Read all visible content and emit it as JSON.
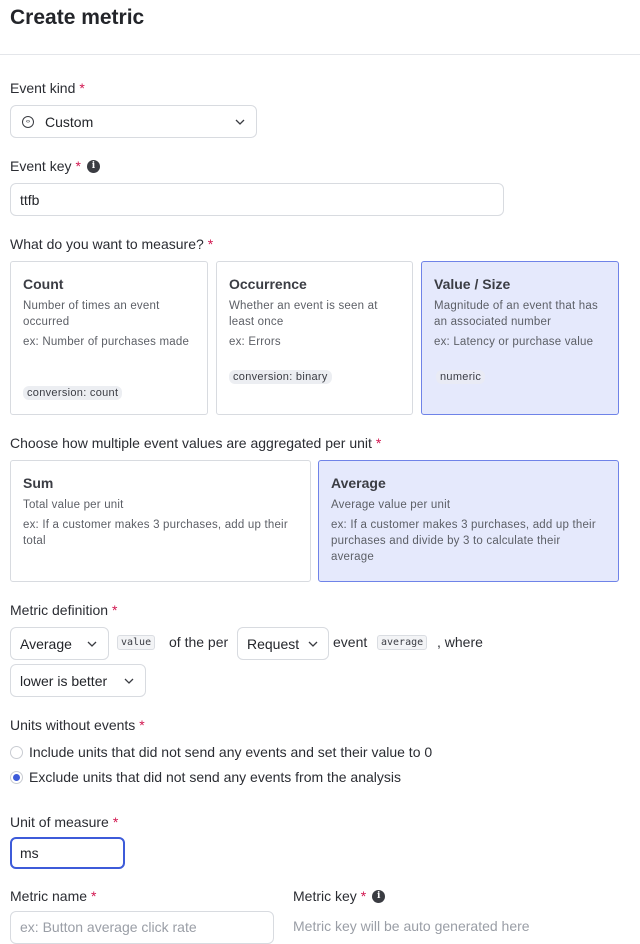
{
  "header": {
    "title": "Create metric"
  },
  "required_mark": "*",
  "event_kind": {
    "label": "Event kind",
    "value": "Custom",
    "icon": "code-brackets-icon"
  },
  "event_key": {
    "label": "Event key",
    "value": "ttfb",
    "info_icon": "i"
  },
  "measure": {
    "label": "What do you want to measure?",
    "options": [
      {
        "title": "Count",
        "desc": "Number of times an event occurred",
        "example": "ex: Number of purchases made",
        "tag": "conversion: count",
        "selected": false
      },
      {
        "title": "Occurrence",
        "desc": "Whether an event is seen at least once",
        "example": "ex: Errors",
        "tag": "conversion: binary",
        "selected": false
      },
      {
        "title": "Value / Size",
        "desc": "Magnitude of an event that has an associated number",
        "example": "ex: Latency or purchase value",
        "tag": "numeric",
        "selected": true
      }
    ]
  },
  "aggregation": {
    "label": "Choose how multiple event values are aggregated per unit",
    "options": [
      {
        "title": "Sum",
        "desc": "Total value per unit",
        "example": "ex: If a customer makes 3 purchases, add up their total",
        "selected": false
      },
      {
        "title": "Average",
        "desc": "Average value per unit",
        "example": "ex: If a customer makes 3 purchases, add up their purchases and divide by 3 to calculate their average",
        "selected": true
      }
    ]
  },
  "definition": {
    "label": "Metric definition",
    "aggregate_select": "Average",
    "value_code": "value",
    "text_of_the_per": "of the per",
    "unit_select": "Request",
    "text_event": "event",
    "event_code": "average",
    "text_where": ", where",
    "direction_select": "lower is better"
  },
  "units_without_events": {
    "label": "Units without events",
    "options": [
      {
        "label": "Include units that did not send any events and set their value to 0",
        "checked": false
      },
      {
        "label": "Exclude units that did not send any events from the analysis",
        "checked": true
      }
    ]
  },
  "unit_of_measure": {
    "label": "Unit of measure",
    "value": "ms"
  },
  "metric_name": {
    "label": "Metric name",
    "placeholder": "ex: Button average click rate"
  },
  "metric_key": {
    "label": "Metric key",
    "placeholder": "Metric key will be auto generated here",
    "info_icon": "i"
  }
}
